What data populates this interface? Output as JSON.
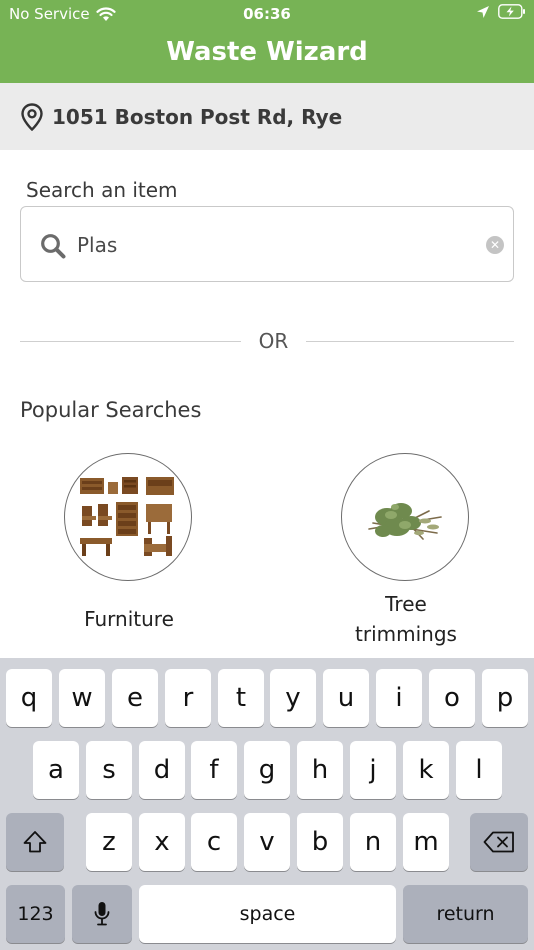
{
  "status_bar": {
    "carrier": "No Service",
    "time": "06:36"
  },
  "app": {
    "title": "Waste Wizard"
  },
  "location": {
    "address": "1051 Boston Post Rd, Rye"
  },
  "search": {
    "label": "Search an item",
    "value": "Plas"
  },
  "divider": {
    "text": "OR"
  },
  "popular": {
    "title": "Popular Searches",
    "items": [
      {
        "label": "Furniture",
        "icon": "furniture-image"
      },
      {
        "label": "Tree trimmings",
        "label_line1": "Tree",
        "label_line2": "trimmings",
        "icon": "tree-trimmings-image"
      }
    ]
  },
  "keyboard": {
    "row1": [
      "q",
      "w",
      "e",
      "r",
      "t",
      "y",
      "u",
      "i",
      "o",
      "p"
    ],
    "row2": [
      "a",
      "s",
      "d",
      "f",
      "g",
      "h",
      "j",
      "k",
      "l"
    ],
    "row3": [
      "z",
      "x",
      "c",
      "v",
      "b",
      "n",
      "m"
    ],
    "numbers_key": "123",
    "space_key": "space",
    "return_key": "return"
  },
  "colors": {
    "header_green": "#77b355",
    "location_bar_bg": "#ebebeb",
    "keyboard_bg": "#d1d3d9"
  }
}
